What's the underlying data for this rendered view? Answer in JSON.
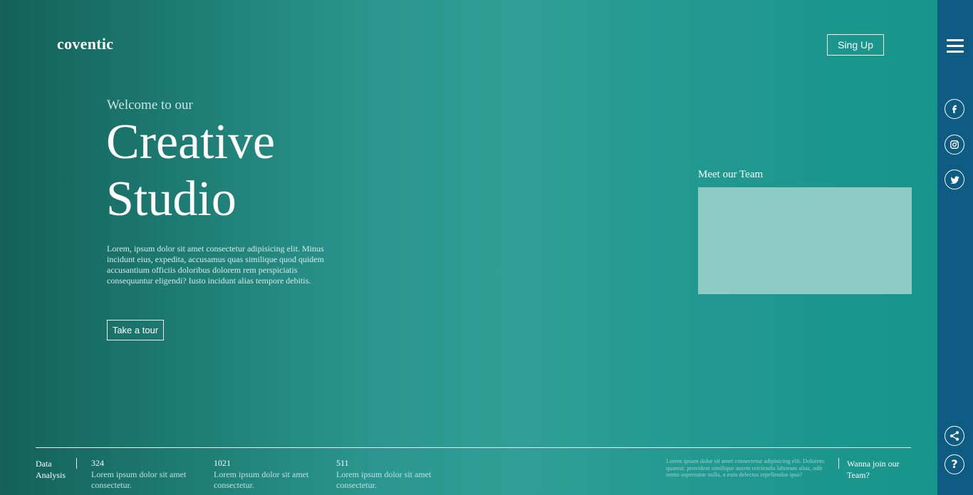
{
  "brand": {
    "name": "coventic"
  },
  "header": {
    "signup_label": "Sing Up"
  },
  "hero": {
    "kicker": "Welcome to our",
    "title_line1": "Creative",
    "title_line2": "Studio",
    "description": "Lorem, ipsum dolor sit amet consectetur adipisicing elit. Minus incidunt eius, expedita, accusamus quas similique quod quidem accusantium officiis doloribus dolorem rem perspiciatis consequuntur eligendi? Iusto incidunt alias tempore debitis.",
    "cta_label": "Take a tour"
  },
  "team": {
    "title": "Meet our Team"
  },
  "footer": {
    "data_label": "Data Analysis",
    "stats": [
      {
        "number": "324",
        "text": "Lorem ipsum dolor sit amet consectetur."
      },
      {
        "number": "1021",
        "text": "Lorem ipsum dolor sit amet consectetur."
      },
      {
        "number": "511",
        "text": "Lorem ipsum dolor sit amet consectetur."
      }
    ],
    "small_text": "Lorem ipsum dolor sit amet consectetur adipisicing elit. Dolorem quaerat, provident similique autem reiciendis laborum alias, odit nemo aspernatur nulla, a eum delectus repellendus ipsa?",
    "join_text": "Wanna join our Team?"
  },
  "sidebar": {
    "icons": [
      "menu-icon",
      "facebook-icon",
      "instagram-icon",
      "twitter-icon",
      "share-icon",
      "help-icon"
    ],
    "help_glyph": "?"
  },
  "colors": {
    "gradient_start": "#136158",
    "gradient_mid": "#2f9f96",
    "gradient_end": "#17958b",
    "sidebar": "#0e5c84",
    "team_box": "#8ecbc4"
  }
}
